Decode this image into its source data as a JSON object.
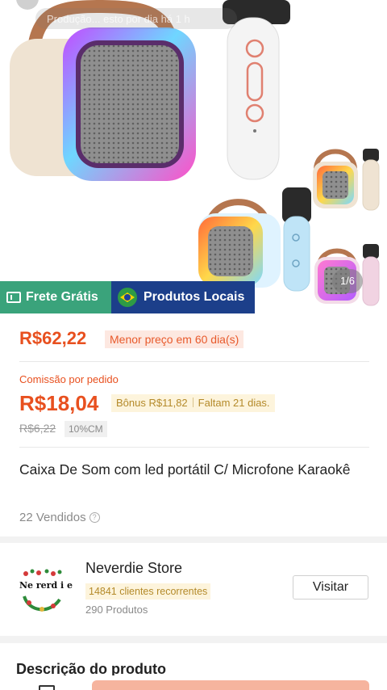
{
  "hero": {
    "overlay_text": "Produção... esto por dia há 1 h",
    "image_counter": "1/6"
  },
  "tags": {
    "frete": "Frete Grátis",
    "locais": "Produtos Locais"
  },
  "price": {
    "current": "R$62,22",
    "lowest_badge": "Menor preço em 60 dia(s)"
  },
  "commission": {
    "label": "Comissão por pedido",
    "value": "R$18,04",
    "bonus": "Bônus R$11,82",
    "remaining": "Faltam 21 dias.",
    "old_value": "R$6,22",
    "rate_badge": "10%CM"
  },
  "product": {
    "title": "Caixa De Som com led portátil C/ Microfone Karaokê",
    "sold": "22 Vendidos"
  },
  "store": {
    "name": "Neverdie Store",
    "logo_text": "Ne rerd i e",
    "recurring_clients": "14841 clientes recorrentes",
    "products": "290 Produtos",
    "visit_label": "Visitar"
  },
  "section": {
    "title": "Descrição do produto"
  },
  "colors": {
    "accent": "#e8501f",
    "frete_tag": "#3aa37b",
    "locais_tag": "#1c3f8a",
    "cta": "#f6b49e"
  },
  "icons": [
    "truck-icon",
    "brazil-flag-icon",
    "help-circle-icon",
    "home-icon"
  ]
}
